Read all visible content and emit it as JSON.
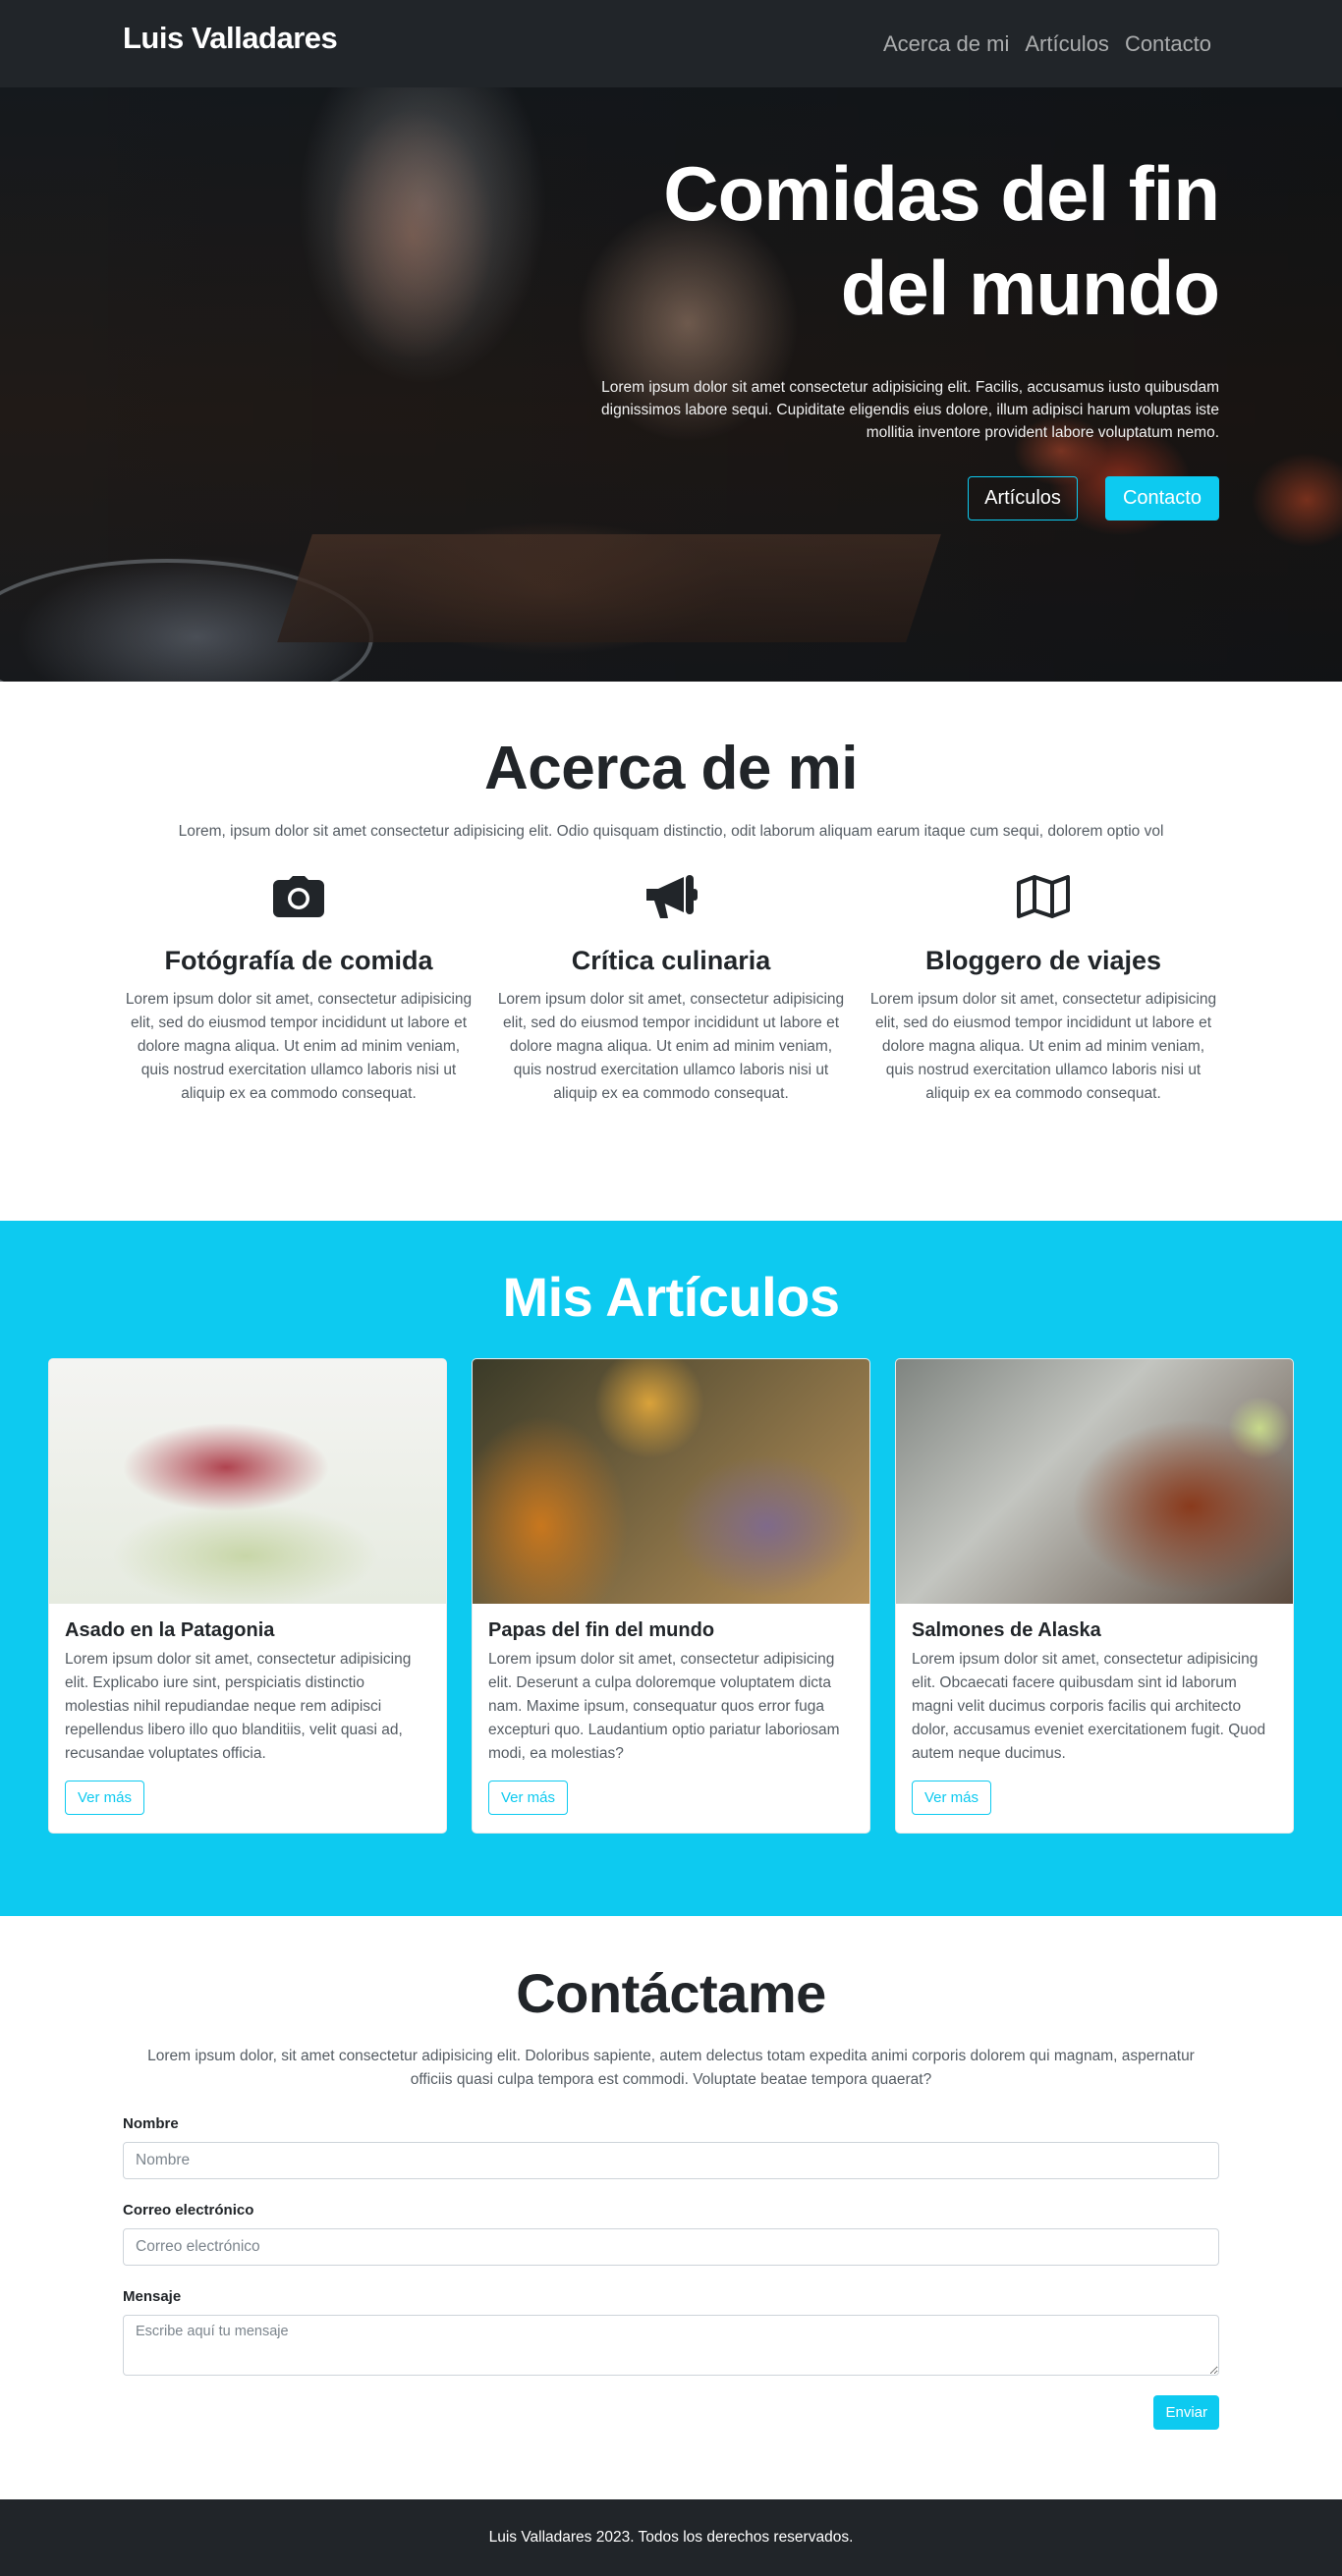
{
  "nav": {
    "brand": "Luis Valladares",
    "links": [
      "Acerca de mi",
      "Artículos",
      "Contacto"
    ]
  },
  "hero": {
    "title_line1": "Comidas del fin",
    "title_line2": "del mundo",
    "text": "Lorem ipsum dolor sit amet consectetur adipisicing elit. Facilis, accusamus iusto quibusdam dignissimos labore sequi. Cupiditate eligendis eius dolore, illum adipisci harum voluptas iste mollitia inventore provident labore voluptatum nemo.",
    "button_articles": "Artículos",
    "button_contact": "Contacto"
  },
  "about": {
    "title": "Acerca de mi",
    "intro": "Lorem, ipsum dolor sit amet consectetur adipisicing elit. Odio quisquam distinctio, odit laborum aliquam earum itaque cum sequi, dolorem optio vol",
    "features": [
      {
        "icon": "camera-icon",
        "title": "Fotógrafía de comida",
        "text": "Lorem ipsum dolor sit amet, consectetur adipisicing elit, sed do eiusmod tempor incididunt ut labore et dolore magna aliqua. Ut enim ad minim veniam, quis nostrud exercitation ullamco laboris nisi ut aliquip ex ea commodo consequat."
      },
      {
        "icon": "megaphone-icon",
        "title": "Crítica culinaria",
        "text": "Lorem ipsum dolor sit amet, consectetur adipisicing elit, sed do eiusmod tempor incididunt ut labore et dolore magna aliqua. Ut enim ad minim veniam, quis nostrud exercitation ullamco laboris nisi ut aliquip ex ea commodo consequat."
      },
      {
        "icon": "map-icon",
        "title": "Bloggero de viajes",
        "text": "Lorem ipsum dolor sit amet, consectetur adipisicing elit, sed do eiusmod tempor incididunt ut labore et dolore magna aliqua. Ut enim ad minim veniam, quis nostrud exercitation ullamco laboris nisi ut aliquip ex ea commodo consequat."
      }
    ]
  },
  "articles": {
    "title": "Mis Artículos",
    "cards": [
      {
        "title": "Asado en la Patagonia",
        "text": "Lorem ipsum dolor sit amet, consectetur adipisicing elit. Explicabo iure sint, perspiciatis distinctio molestias nihil repudiandae neque rem adipisci repellendus libero illo quo blanditiis, velit quasi ad, recusandae voluptates officia.",
        "button": "Ver más"
      },
      {
        "title": "Papas del fin del mundo",
        "text": "Lorem ipsum dolor sit amet, consectetur adipisicing elit. Deserunt a culpa doloremque voluptatem dicta nam. Maxime ipsum, consequatur quos error fuga excepturi quo. Laudantium optio pariatur laboriosam modi, ea molestias?",
        "button": "Ver más"
      },
      {
        "title": "Salmones de Alaska",
        "text": "Lorem ipsum dolor sit amet, consectetur adipisicing elit. Obcaecati facere quibusdam sint id laborum magni velit ducimus corporis facilis qui architecto dolor, accusamus eveniet exercitationem fugit. Quod autem neque ducimus.",
        "button": "Ver más"
      }
    ]
  },
  "contact": {
    "title": "Contáctame",
    "intro": "Lorem ipsum dolor, sit amet consectetur adipisicing elit. Doloribus sapiente, autem delectus totam expedita animi corporis dolorem qui magnam, aspernatur officiis quasi culpa tempora est commodi. Voluptate beatae tempora quaerat?",
    "name_label": "Nombre",
    "name_placeholder": "Nombre",
    "email_label": "Correo electrónico",
    "email_placeholder": "Correo electrónico",
    "message_label": "Mensaje",
    "message_placeholder": "Escribe aquí tu mensaje",
    "submit": "Enviar"
  },
  "footer": {
    "text": "Luis Valladares 2023. Todos los derechos reservados."
  },
  "colors": {
    "accent": "#0dcaf0",
    "dark": "#212529"
  }
}
